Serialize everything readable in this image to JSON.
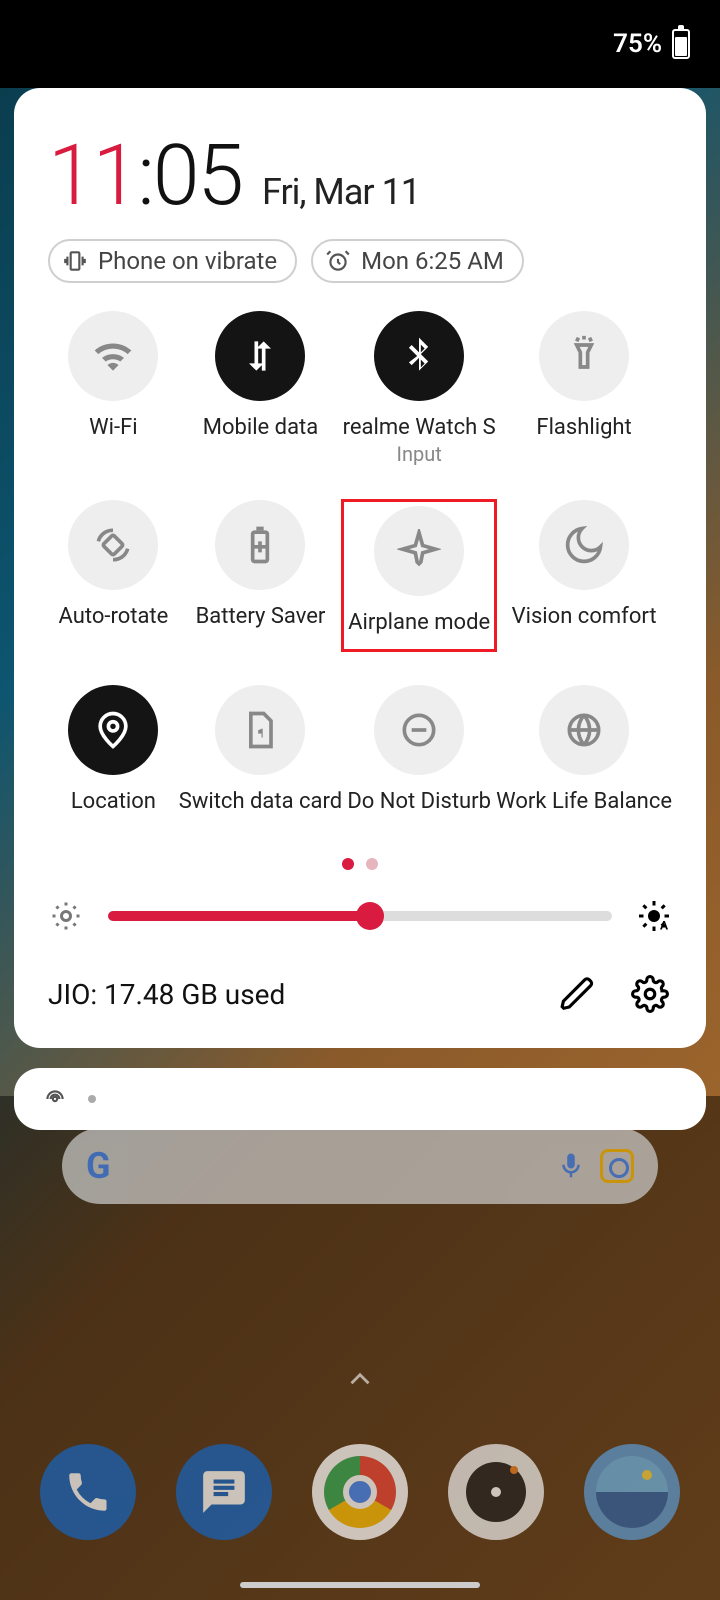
{
  "statusbar": {
    "battery_pct": "75%"
  },
  "clock": {
    "hours": "11",
    "minutes": "05",
    "date": "Fri, Mar 11"
  },
  "chips": {
    "vibrate": "Phone on vibrate",
    "alarm": "Mon 6:25 AM"
  },
  "tiles": [
    {
      "id": "wifi",
      "label": "Wi-Fi",
      "sub": "",
      "on": false,
      "highlighted": false,
      "icon": "wifi"
    },
    {
      "id": "mobile-data",
      "label": "Mobile data",
      "sub": "",
      "on": true,
      "highlighted": false,
      "icon": "data"
    },
    {
      "id": "watch",
      "label": "realme Watch S",
      "sub": "Input",
      "on": true,
      "highlighted": false,
      "icon": "bluetooth"
    },
    {
      "id": "flashlight",
      "label": "Flashlight",
      "sub": "",
      "on": false,
      "highlighted": false,
      "icon": "flashlight"
    },
    {
      "id": "auto-rotate",
      "label": "Auto-rotate",
      "sub": "",
      "on": false,
      "highlighted": false,
      "icon": "rotate"
    },
    {
      "id": "battery-saver",
      "label": "Battery Saver",
      "sub": "",
      "on": false,
      "highlighted": false,
      "icon": "battery"
    },
    {
      "id": "airplane",
      "label": "Airplane mode",
      "sub": "",
      "on": false,
      "highlighted": true,
      "icon": "airplane"
    },
    {
      "id": "vision",
      "label": "Vision comfort",
      "sub": "",
      "on": false,
      "highlighted": false,
      "icon": "moon"
    },
    {
      "id": "location",
      "label": "Location",
      "sub": "",
      "on": true,
      "highlighted": false,
      "icon": "location"
    },
    {
      "id": "switch-sim",
      "label": "Switch data card",
      "sub": "",
      "on": false,
      "highlighted": false,
      "icon": "sim"
    },
    {
      "id": "dnd",
      "label": "Do Not Disturb",
      "sub": "",
      "on": false,
      "highlighted": false,
      "icon": "dnd"
    },
    {
      "id": "wlb",
      "label": "Work Life Balance",
      "sub": "",
      "on": false,
      "highlighted": false,
      "icon": "globe"
    }
  ],
  "brightness": {
    "percent": 52
  },
  "footer": {
    "data_usage": "JIO: 17.48 GB used"
  },
  "dock": [
    "Phone",
    "Messages",
    "Chrome",
    "Camera",
    "Gallery"
  ]
}
